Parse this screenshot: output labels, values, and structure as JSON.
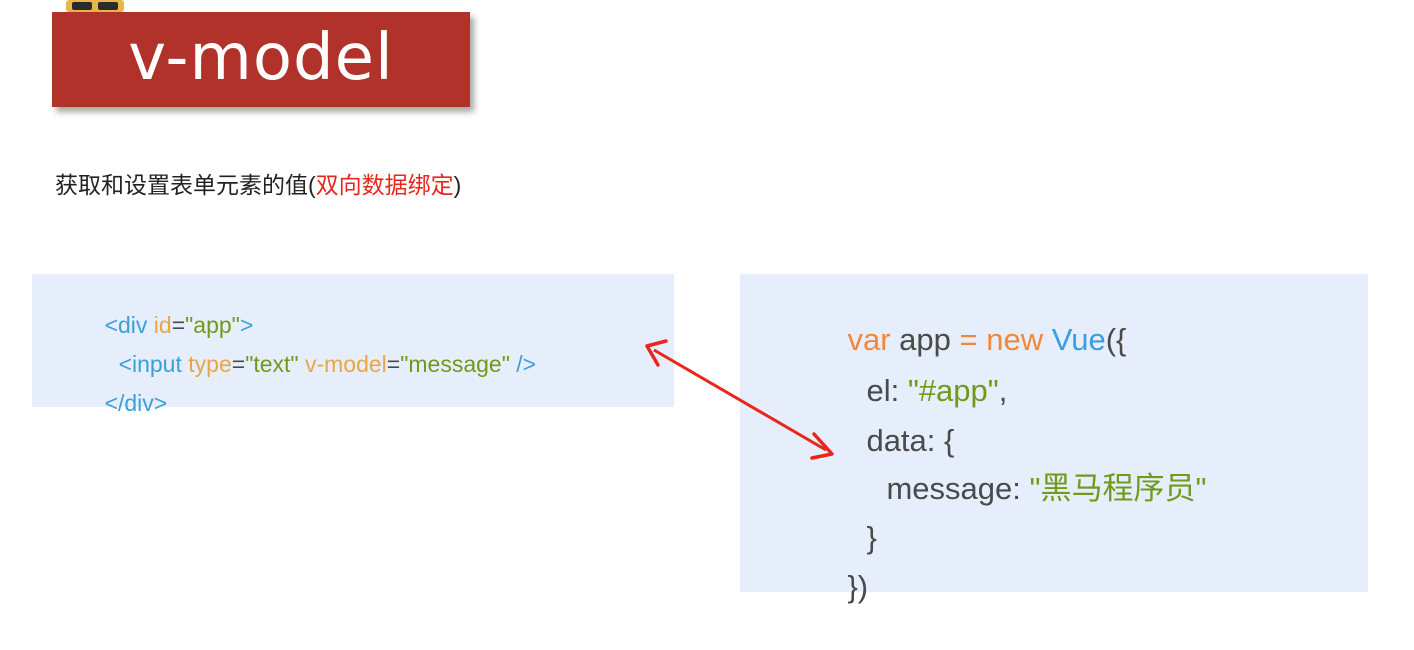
{
  "title": "v-model",
  "description": {
    "prefix": "获取和设置表单元素的值(",
    "highlight": "双向数据绑定",
    "suffix": ")"
  },
  "html_snippet": {
    "line1": {
      "open": "<div ",
      "attr": "id",
      "eq": "=",
      "value": "\"app\"",
      "close": ">"
    },
    "line2": {
      "open": "<input ",
      "attr1": "type",
      "eq1": "=",
      "value1": "\"text\"",
      "space": " ",
      "attr2": "v-model",
      "eq2": "=",
      "value2": "\"message\"",
      "close": " />"
    },
    "line3": {
      "text": "</div>"
    }
  },
  "js_snippet": {
    "line1": {
      "kw1": "var",
      "name": " app ",
      "eq": "=",
      "sp": " ",
      "kw2": "new",
      "sp2": " ",
      "cls": "Vue",
      "rest": "({"
    },
    "line2": {
      "key": "el: ",
      "value": "\"#app\"",
      "tail": ","
    },
    "line3": {
      "text": "data: {"
    },
    "line4": {
      "key": "message: ",
      "q1": "\"",
      "value": "黑马程序员",
      "q2": "\""
    },
    "line5": {
      "text": "}"
    },
    "line6": {
      "text": "})"
    }
  },
  "colors": {
    "banner": "#b0322a",
    "highlight": "#e8261c",
    "code_bg": "#e7eefb",
    "arrow": "#e8261c"
  }
}
